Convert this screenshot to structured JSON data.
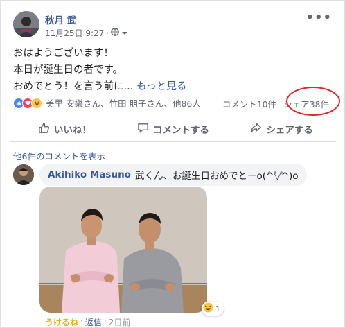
{
  "post": {
    "author": "秋月 武",
    "date": "11月25日 9:27",
    "separator": "·",
    "text_lines": [
      "おはようございます！",
      "本日が誕生日の者です。",
      "おめでとう！を言う前に..."
    ],
    "see_more": "もっと見る"
  },
  "reactions": {
    "names": "美里 安樂さん、竹田 朋子さん、他86人",
    "comments_count": "コメント10件",
    "shares_count": "シェア38件"
  },
  "actions": {
    "like": "いいね！",
    "comment": "コメントする",
    "share": "シェアする"
  },
  "comments": {
    "view_more": "他6件のコメントを表示",
    "item": {
      "author": "Akihiko Masuno",
      "text": "武くん、お誕生日おめでとーo(^▽^)o",
      "reaction_count": "1",
      "react_label": "うけるね",
      "dot1": "·",
      "reply_label": "返信",
      "dot2": "·",
      "time": "2日前"
    }
  },
  "colors": {
    "link": "#385898",
    "highlight_circle": "#e0262a",
    "like_blue": "#4c83f0",
    "love_red": "#f0445c",
    "haha_yellow": "#f7c544"
  }
}
